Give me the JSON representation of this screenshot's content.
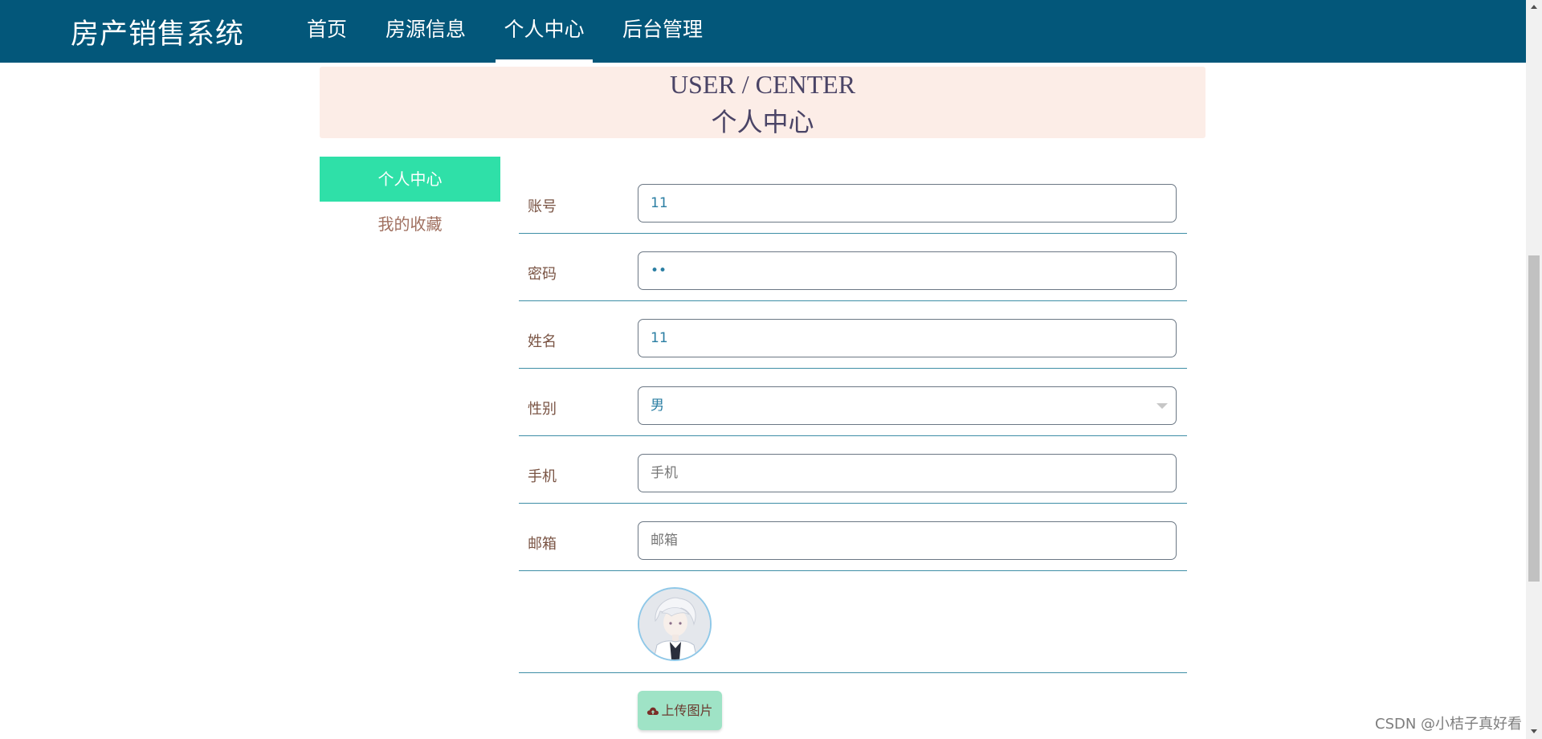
{
  "header": {
    "brand": "房产销售系统",
    "nav": [
      {
        "label": "首页",
        "active": false
      },
      {
        "label": "房源信息",
        "active": false
      },
      {
        "label": "个人中心",
        "active": true
      },
      {
        "label": "后台管理",
        "active": false
      }
    ]
  },
  "banner": {
    "title_en": "USER / CENTER",
    "title_cn": "个人中心"
  },
  "sidebar": {
    "items": [
      {
        "label": "个人中心",
        "active": true
      },
      {
        "label": "我的收藏",
        "active": false
      }
    ]
  },
  "form": {
    "account": {
      "label": "账号",
      "value": "11"
    },
    "password": {
      "label": "密码",
      "value": "11"
    },
    "name": {
      "label": "姓名",
      "value": "11"
    },
    "gender": {
      "label": "性别",
      "value": "男"
    },
    "phone": {
      "label": "手机",
      "value": "",
      "placeholder": "手机"
    },
    "email": {
      "label": "邮箱",
      "value": "",
      "placeholder": "邮箱"
    },
    "avatar_icon": "user-avatar-image",
    "upload_label": "上传图片",
    "upload_icon": "cloud-upload-icon"
  },
  "watermark": "CSDN @小桔子真好看",
  "colors": {
    "topbar": "#03577a",
    "banner_bg": "#fcede7",
    "sidebar_active": "#2fe0a8",
    "upload_button": "#9fe3c6",
    "row_divider": "#3e8ea6"
  }
}
